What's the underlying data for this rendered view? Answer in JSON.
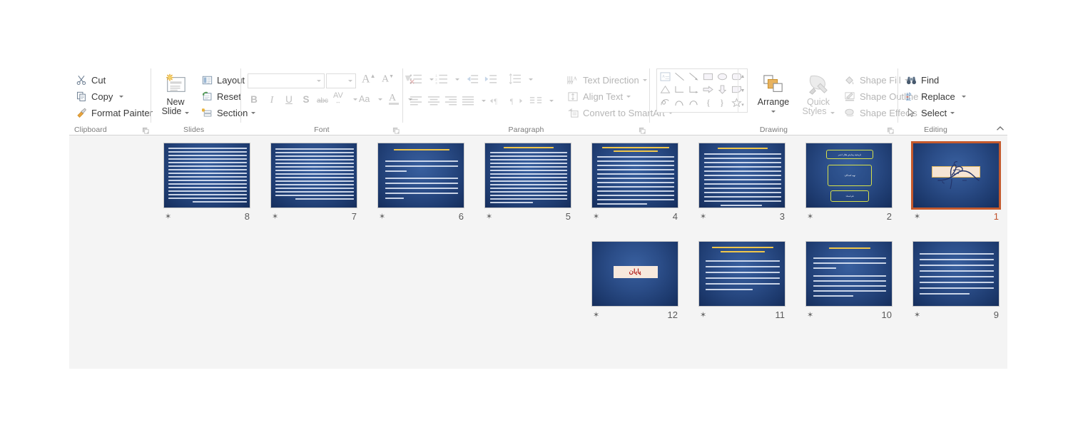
{
  "app": {
    "name": "PowerPoint Home Ribbon",
    "ribbon_collapse_icon": "chevron-up-icon"
  },
  "ribbon": {
    "groups": [
      {
        "id": "clipboard",
        "label": "Clipboard",
        "has_dialog_launcher": true
      },
      {
        "id": "slides",
        "label": "Slides",
        "has_dialog_launcher": false
      },
      {
        "id": "font",
        "label": "Font",
        "has_dialog_launcher": true
      },
      {
        "id": "paragraph",
        "label": "Paragraph",
        "has_dialog_launcher": true
      },
      {
        "id": "drawing",
        "label": "Drawing",
        "has_dialog_launcher": true
      },
      {
        "id": "editing",
        "label": "Editing",
        "has_dialog_launcher": false
      }
    ],
    "clipboard": {
      "cut": "Cut",
      "copy": "Copy",
      "format_painter": "Format Painter"
    },
    "slides": {
      "new_slide_line1": "New",
      "new_slide_line2": "Slide",
      "layout": "Layout",
      "reset": "Reset",
      "section": "Section"
    },
    "font": {
      "font_name_value": "",
      "font_name_placeholder": "",
      "font_size_value": "",
      "font_size_placeholder": "",
      "grow_font": "A",
      "shrink_font": "A",
      "clear_formatting": "clear-formatting-icon",
      "bold": "B",
      "italic": "I",
      "underline": "U",
      "shadow": "S",
      "strikethrough": "abc",
      "character_spacing": "AV",
      "change_case": "Aa",
      "font_color": "A"
    },
    "paragraph": {
      "text_direction": "Text Direction",
      "align_text": "Align Text",
      "convert_to_smartart": "Convert to SmartArt"
    },
    "drawing": {
      "arrange": "Arrange",
      "quick_styles_line1": "Quick",
      "quick_styles_line2": "Styles",
      "shape_fill": "Shape Fill",
      "shape_outline": "Shape Outline",
      "shape_effects": "Shape Effects"
    },
    "editing": {
      "find": "Find",
      "replace": "Replace",
      "select": "Select"
    }
  },
  "slide_pane": {
    "animation_icon": "animation-star-icon",
    "selected_slide": 1,
    "slides": [
      {
        "number": "8",
        "row": 0,
        "col": 0,
        "kind": "body-only",
        "title": "",
        "selected": false
      },
      {
        "number": "7",
        "row": 0,
        "col": 1,
        "kind": "body-only",
        "title": "",
        "selected": false
      },
      {
        "number": "6",
        "row": 0,
        "col": 2,
        "kind": "title-body",
        "title": "جمعیت هلال احمر جمهوری اسلامی ایران",
        "selected": false
      },
      {
        "number": "5",
        "row": 0,
        "col": 3,
        "kind": "title-body",
        "title": "آشنایی بیشتر گلبال هلال احمر",
        "selected": false
      },
      {
        "number": "4",
        "row": 0,
        "col": 4,
        "kind": "title-body",
        "title": "وظایف عمده جمعیت هلال احمر در سطح ملی و بین المللی عبارتند",
        "selected": false
      },
      {
        "number": "3",
        "row": 0,
        "col": 5,
        "kind": "title-body",
        "title": "تاریخچه پیدایش هلال احمر",
        "selected": false
      },
      {
        "number": "2",
        "row": 0,
        "col": 6,
        "kind": "boxes",
        "title": "تاریخچه پیدایش هلال احمر",
        "box1": "تهیه کنندگان:",
        "box2": "نام استاد:",
        "selected": false
      },
      {
        "number": "1",
        "row": 0,
        "col": 7,
        "kind": "bismillah",
        "title": "بسم الله الرحمن الرحیم",
        "selected": true
      },
      {
        "number": "12",
        "row": 1,
        "col": 3,
        "kind": "end",
        "title": "پایان",
        "selected": false
      },
      {
        "number": "11",
        "row": 1,
        "col": 4,
        "kind": "title-body",
        "title": "سیاستها و استراتژی های ثبت شده در اساس نامه جمعیت هلال احمر در رابطه با جوانان",
        "selected": false
      },
      {
        "number": "10",
        "row": 1,
        "col": 5,
        "kind": "title-body",
        "title": "اهداف سازمان جوانان :",
        "selected": false
      },
      {
        "number": "9",
        "row": 1,
        "col": 6,
        "kind": "body-only",
        "title": "",
        "selected": false
      }
    ]
  },
  "colors": {
    "selection_border": "#c55a2d",
    "slide_blue": "#2b4d88",
    "slide_title_gold": "#f2c94c",
    "end_text_red": "#b3201d",
    "pane_background": "#f4f4f4",
    "box_outline_yellow": "#d7e14a",
    "calligraphy_box": "#f6e5d4"
  }
}
